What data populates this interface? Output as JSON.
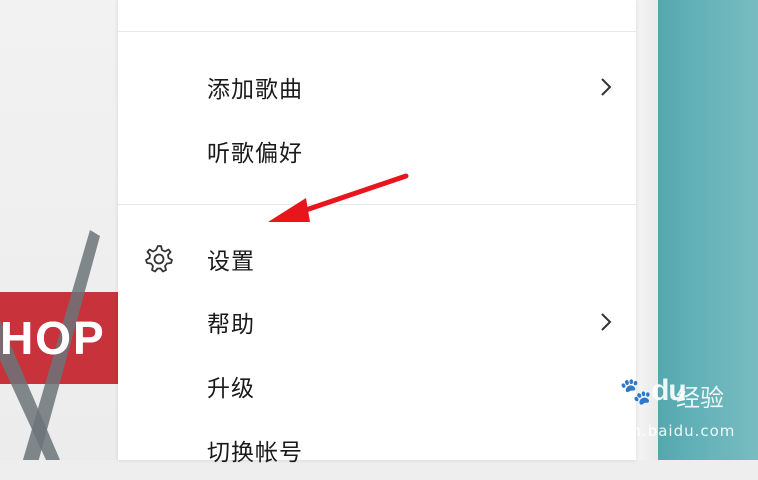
{
  "menu": {
    "items": [
      {
        "label": "添加歌曲",
        "has_submenu": true,
        "icon": null
      },
      {
        "label": "听歌偏好",
        "has_submenu": false,
        "icon": null
      },
      {
        "label": "设置",
        "has_submenu": false,
        "icon": "gear-icon"
      },
      {
        "label": "帮助",
        "has_submenu": true,
        "icon": null
      },
      {
        "label": "升级",
        "has_submenu": false,
        "icon": null
      },
      {
        "label": "切换帐号",
        "has_submenu": false,
        "icon": null
      }
    ]
  },
  "background": {
    "left_banner_text": "HOP",
    "right_color": "#5fb0b6",
    "banner_red": "#c8323a"
  },
  "annotation": {
    "arrow_color": "#e8161c",
    "points_to": "设置"
  },
  "watermark": {
    "brand": "Bai",
    "brand_suffix": "du",
    "product": "经验",
    "url": "jingyan.baidu.com"
  }
}
